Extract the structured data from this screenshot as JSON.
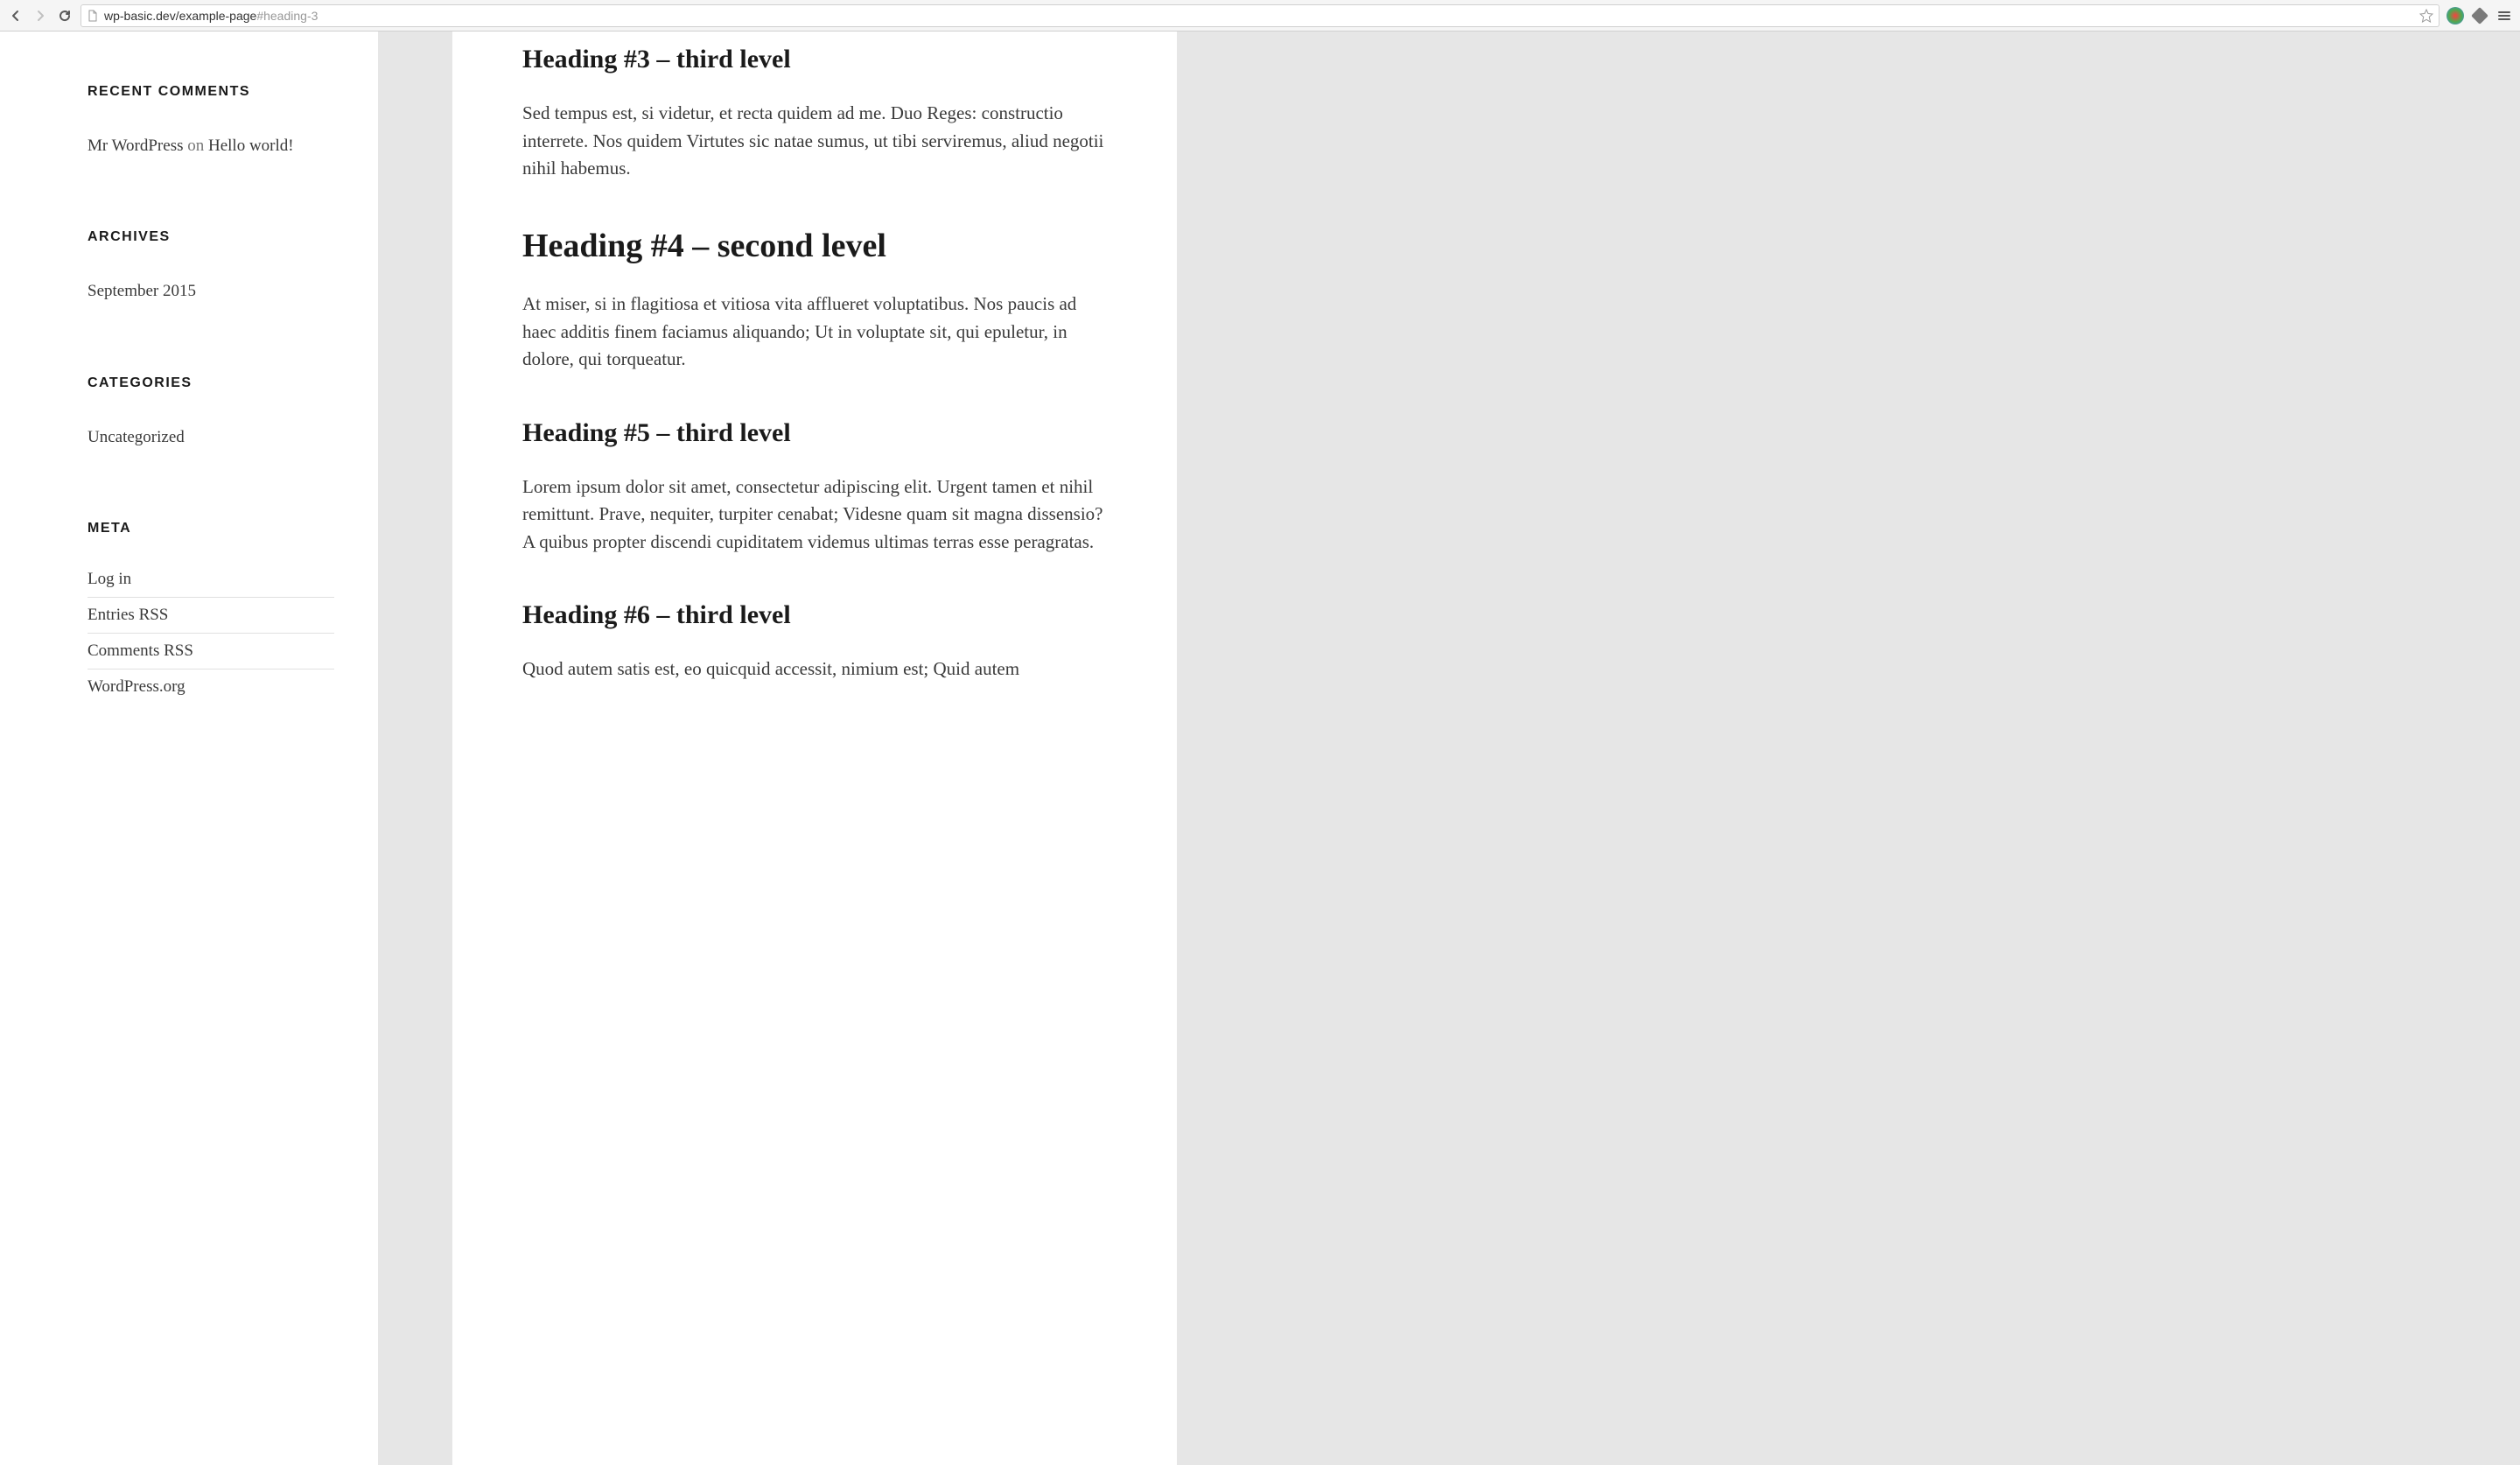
{
  "browser": {
    "url_host": "wp-basic.dev",
    "url_path": "/example-page",
    "url_fragment": "#heading-3"
  },
  "sidebar": {
    "recent_comments": {
      "title": "RECENT COMMENTS",
      "items": [
        {
          "author": "Mr WordPress",
          "on": " on ",
          "post": "Hello world!"
        }
      ]
    },
    "archives": {
      "title": "ARCHIVES",
      "items": [
        "September 2015"
      ]
    },
    "categories": {
      "title": "CATEGORIES",
      "items": [
        "Uncategorized"
      ]
    },
    "meta": {
      "title": "META",
      "items": [
        "Log in",
        "Entries RSS",
        "Comments RSS",
        "WordPress.org"
      ]
    }
  },
  "content": {
    "sections": [
      {
        "level": 3,
        "heading": "Heading #3 – third level",
        "body": "Sed tempus est, si videtur, et recta quidem ad me. Duo Reges: constructio interrete. Nos quidem Virtutes sic natae sumus, ut tibi serviremus, aliud negotii nihil habemus."
      },
      {
        "level": 2,
        "heading": "Heading #4 – second level",
        "body": "At miser, si in flagitiosa et vitiosa vita afflueret voluptatibus. Nos paucis ad haec additis finem faciamus aliquando; Ut in voluptate sit, qui epuletur, in dolore, qui torqueatur."
      },
      {
        "level": 3,
        "heading": "Heading #5 – third level",
        "body": "Lorem ipsum dolor sit amet, consectetur adipiscing elit. Urgent tamen et nihil remittunt. Prave, nequiter, turpiter cenabat; Videsne quam sit magna dissensio? A quibus propter discendi cupiditatem videmus ultimas terras esse peragratas."
      },
      {
        "level": 3,
        "heading": "Heading #6 – third level",
        "body": "Quod autem satis est, eo quicquid accessit, nimium est; Quid autem"
      }
    ]
  }
}
